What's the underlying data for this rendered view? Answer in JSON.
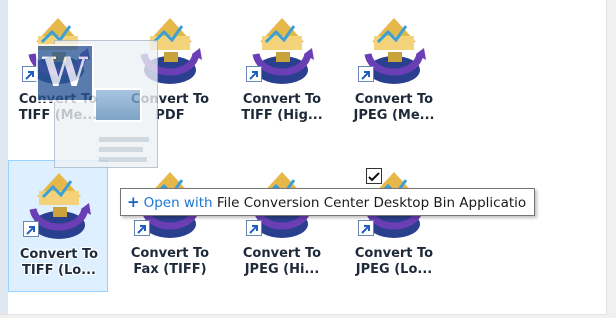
{
  "icons": [
    {
      "line1": "Convert To",
      "line2": "TIFF (Me...",
      "shortcut": true,
      "checked": false,
      "selected": false
    },
    {
      "line1": "Convert To",
      "line2": "PDF",
      "shortcut": false,
      "checked": false,
      "selected": false
    },
    {
      "line1": "Convert To",
      "line2": "TIFF (Hig...",
      "shortcut": true,
      "checked": false,
      "selected": false
    },
    {
      "line1": "Convert To",
      "line2": "JPEG (Me...",
      "shortcut": true,
      "checked": false,
      "selected": false
    },
    {
      "line1": "Convert To",
      "line2": "TIFF (Lo...",
      "shortcut": true,
      "checked": false,
      "selected": true
    },
    {
      "line1": "Convert To",
      "line2": "Fax (TIFF)",
      "shortcut": true,
      "checked": false,
      "selected": false
    },
    {
      "line1": "Convert To",
      "line2": "JPEG (Hi...",
      "shortcut": true,
      "checked": false,
      "selected": false
    },
    {
      "line1": "Convert To",
      "line2": "JPEG (Lo...",
      "shortcut": true,
      "checked": true,
      "selected": false
    }
  ],
  "drag_ghost": {
    "badge_letter": "W",
    "icon": "word-document-icon"
  },
  "tooltip": {
    "plus": "+",
    "verb": "Open with",
    "target": "File Conversion Center Desktop Bin Applicatio"
  },
  "colors": {
    "selection": "#cce8ff",
    "shortcut_arrow": "#1f5fbf",
    "tooltip_verb": "#1976d2"
  }
}
